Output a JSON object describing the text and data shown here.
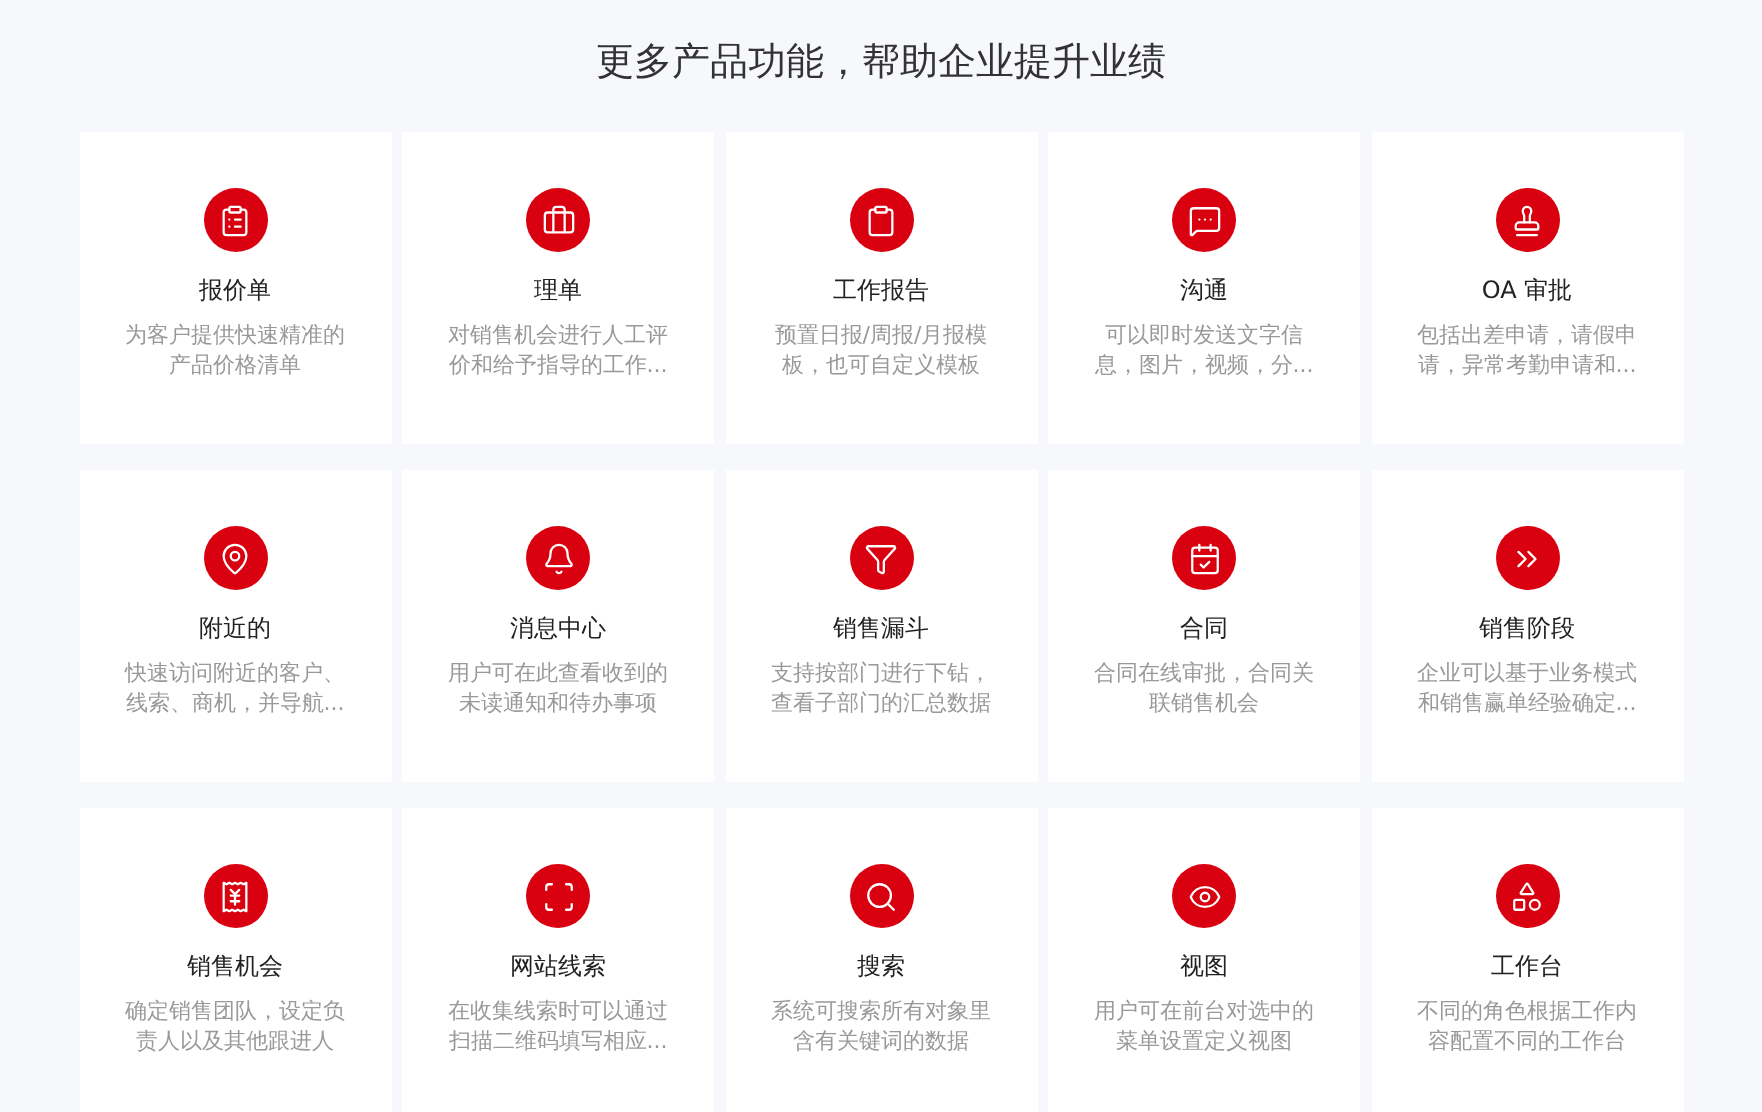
{
  "title": "更多产品功能，帮助企业提升业绩",
  "features": [
    {
      "name": "报价单",
      "description": [
        "为客户提供快速精准的",
        "产品价格清单"
      ]
    },
    {
      "name": "理单",
      "description": [
        "对销售机会进行人工评",
        "价和给予指导的工作..."
      ]
    },
    {
      "name": "工作报告",
      "description": [
        "预置日报/周报/月报模",
        "板，也可自定义模板"
      ]
    },
    {
      "name": "沟通",
      "description": [
        "可以即时发送文字信",
        "息，图片，视频，分..."
      ]
    },
    {
      "name": "OA 审批",
      "description": [
        "包括出差申请，请假申",
        "请，异常考勤申请和..."
      ]
    },
    {
      "name": "附近的",
      "description": [
        "快速访问附近的客户、",
        "线索、商机，并导航..."
      ]
    },
    {
      "name": "消息中心",
      "description": [
        "用户可在此查看收到的",
        "未读通知和待办事项"
      ]
    },
    {
      "name": "销售漏斗",
      "description": [
        "支持按部门进行下钻，",
        "查看子部门的汇总数据"
      ]
    },
    {
      "name": "合同",
      "description": [
        "合同在线审批，合同关",
        "联销售机会"
      ]
    },
    {
      "name": "销售阶段",
      "description": [
        "企业可以基于业务模式",
        "和销售赢单经验确定..."
      ]
    },
    {
      "name": "销售机会",
      "description": [
        "确定销售团队，设定负",
        "责人以及其他跟进人"
      ]
    },
    {
      "name": "网站线索",
      "description": [
        "在收集线索时可以通过",
        "扫描二维码填写相应..."
      ]
    },
    {
      "name": "搜索",
      "description": [
        "系统可搜索所有对象里",
        "含有关键词的数据"
      ]
    },
    {
      "name": "视图",
      "description": [
        "用户可在前台对选中的",
        "菜单设置定义视图"
      ]
    },
    {
      "name": "工作台",
      "description": [
        "不同的角色根据工作内",
        "容配置不同的工作台"
      ]
    }
  ]
}
